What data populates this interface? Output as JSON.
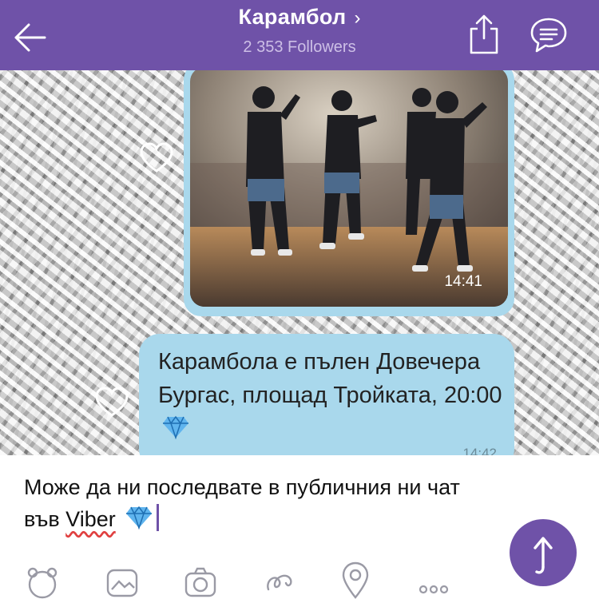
{
  "header": {
    "title": "Карамбол",
    "chevron": "›",
    "followers": "2 353 Followers",
    "background_color": "#6f52a8",
    "icons": [
      "back-arrow-icon",
      "share-icon",
      "chat-info-icon"
    ]
  },
  "messages": [
    {
      "type": "image",
      "image_description": "photo",
      "time": "14:41",
      "icon": "heart-icon"
    },
    {
      "type": "text",
      "text": "Карамбола е пълен Довечера Бургас, площад Тройката, 20:00",
      "emoji": "gem-icon",
      "time": "14:42",
      "icon": "heart-icon"
    }
  ],
  "bubble_color": "#a9d8ec",
  "composer": {
    "text_before": "Може да ни последвате в публичния ни чат във ",
    "text_misspelled": "Viber",
    "emoji": "gem-icon",
    "send_icon": "send-arrow-icon"
  },
  "toolbar": {
    "icons": [
      "sticker-icon",
      "gallery-icon",
      "camera-icon",
      "doodle-icon",
      "location-icon",
      "more-icon"
    ]
  }
}
